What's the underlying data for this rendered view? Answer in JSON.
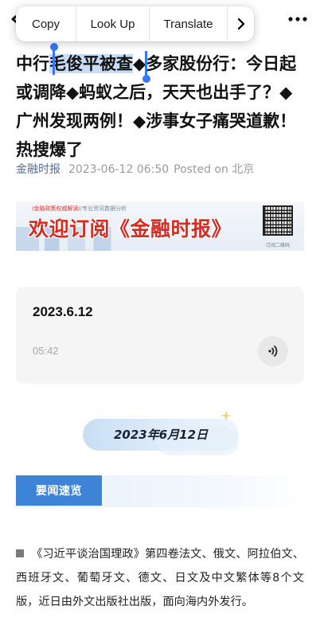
{
  "context_menu": {
    "items": [
      "Copy",
      "Look Up",
      "Translate"
    ],
    "next_icon": "chevron-right-icon"
  },
  "icons": {
    "back": "back-arrow-icon",
    "more": "more-dots-icon",
    "play": "audio-wave-icon",
    "sparkle": "sparkle-icon"
  },
  "article": {
    "title_before_selection": "中行",
    "title_selected": "毛俊平被查",
    "title_after_selection": "◆多家股份行：今日起或调降◆蚂蚁之后，天天也出手了？◆广州发现两例！◆涉事女子痛哭道歉！热搜爆了",
    "source": "金融时报",
    "date": "2023-06-12 06:50",
    "posted": "Posted on 北京"
  },
  "banner": {
    "tagline_left": "/金融政策权威解读/",
    "tagline_right": "/专业资讯数据分析",
    "title": "欢迎订阅《金融时报》",
    "qr_caption": "订阅二维码"
  },
  "audio": {
    "title": "2023.6.12",
    "duration": "05:42"
  },
  "date_pill": "2023年6月12日",
  "section": {
    "label": "要闻速览"
  },
  "paragraph": "《习近平谈治国理政》第四卷法文、俄文、阿拉伯文、西班牙文、葡萄牙文、德文、日文及中文繁体等8个文版，近日由外文出版社出版，面向海内外发行。",
  "colors": {
    "selection": "#c9dcf6",
    "selection_handle": "#3478f6",
    "source_link": "#576b95",
    "section_blue": "#3d84d6",
    "banner_red": "#d32d24"
  }
}
